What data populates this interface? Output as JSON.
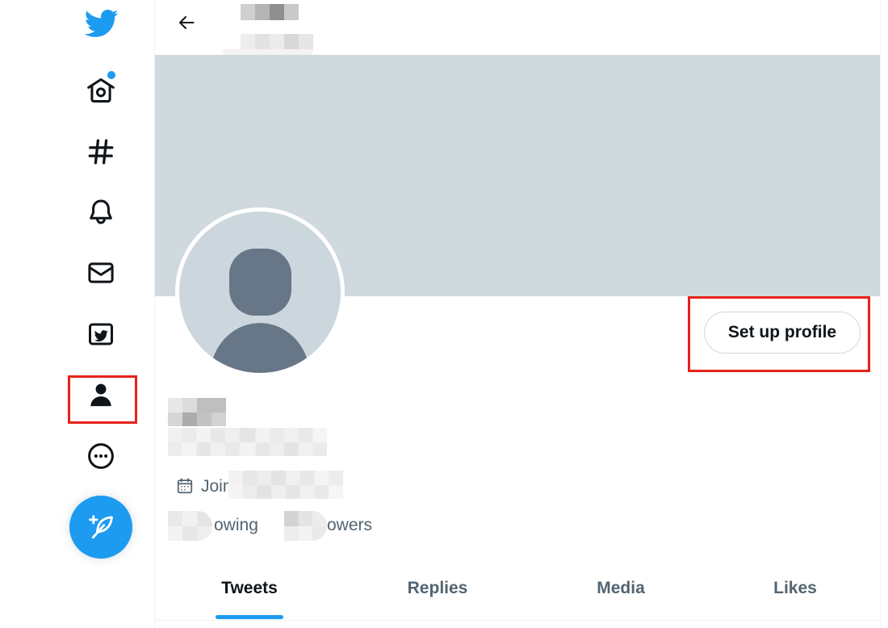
{
  "colors": {
    "accent": "#1d9bf0",
    "text_primary": "#0f1419",
    "text_secondary": "#536471",
    "banner": "#cfd9de",
    "highlight_box": "#e8221b"
  },
  "sidebar": {
    "logo_icon": "twitter-bird-icon",
    "items": [
      {
        "icon": "home-icon",
        "notification_dot": true
      },
      {
        "icon": "hashtag-icon"
      },
      {
        "icon": "bell-icon"
      },
      {
        "icon": "mail-icon"
      },
      {
        "icon": "twitter-blue-icon"
      },
      {
        "icon": "person-icon",
        "active": true,
        "highlighted": true
      },
      {
        "icon": "more-icon"
      }
    ],
    "compose_icon": "compose-tweet-icon"
  },
  "header": {
    "back_icon": "back-arrow-icon"
  },
  "profile": {
    "setup_button": "Set up profile",
    "setup_button_highlighted": true,
    "calendar_icon": "calendar-icon",
    "joined": "Join",
    "following": "owing",
    "followers": "owers"
  },
  "tabs": [
    {
      "label": "Tweets",
      "selected": true
    },
    {
      "label": "Replies",
      "selected": false
    },
    {
      "label": "Media",
      "selected": false
    },
    {
      "label": "Likes",
      "selected": false
    }
  ]
}
